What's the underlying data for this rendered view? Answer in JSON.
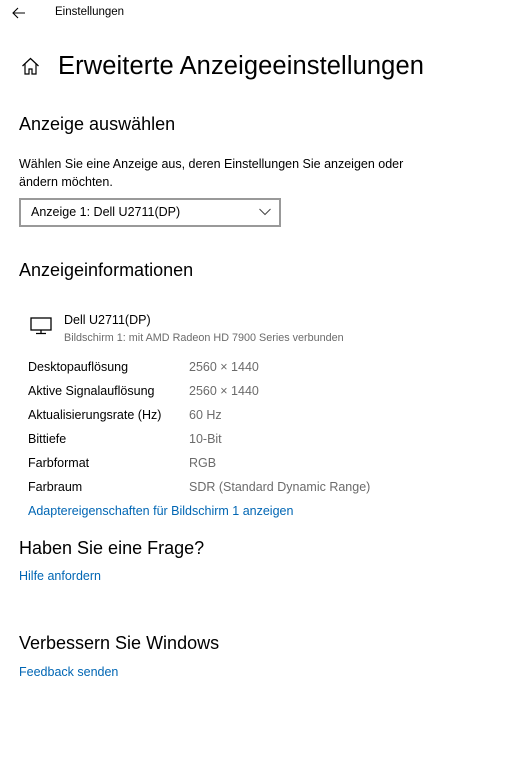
{
  "titlebar": {
    "back_icon": "back-arrow-icon",
    "title": "Einstellungen"
  },
  "header": {
    "home_icon": "home-icon",
    "title": "Erweiterte Anzeigeeinstellungen"
  },
  "select_display": {
    "heading": "Anzeige auswählen",
    "description": "Wählen Sie eine Anzeige aus, deren Einstellungen Sie anzeigen oder ändern möchten.",
    "selected": "Anzeige 1: Dell U2711(DP)"
  },
  "display_info": {
    "heading": "Anzeigeinformationen",
    "monitor_icon": "monitor-icon",
    "monitor_name": "Dell U2711(DP)",
    "monitor_subtitle": "Bildschirm 1: mit AMD Radeon HD 7900 Series verbunden",
    "rows": [
      {
        "label": "Desktopauflösung",
        "value": "2560 × 1440"
      },
      {
        "label": "Aktive Signalauflösung",
        "value": "2560 × 1440"
      },
      {
        "label": "Aktualisierungsrate (Hz)",
        "value": "60 Hz"
      },
      {
        "label": "Bittiefe",
        "value": "10-Bit"
      },
      {
        "label": "Farbformat",
        "value": "RGB"
      },
      {
        "label": "Farbraum",
        "value": "SDR (Standard Dynamic Range)"
      }
    ],
    "adapter_link": "Adaptereigenschaften für Bildschirm 1 anzeigen"
  },
  "question": {
    "heading": "Haben Sie eine Frage?",
    "link": "Hilfe anfordern"
  },
  "improve": {
    "heading": "Verbessern Sie Windows",
    "link": "Feedback senden"
  },
  "colors": {
    "link": "#0066b4",
    "secondary_text": "#6b6b6b",
    "select_border": "#999999"
  }
}
